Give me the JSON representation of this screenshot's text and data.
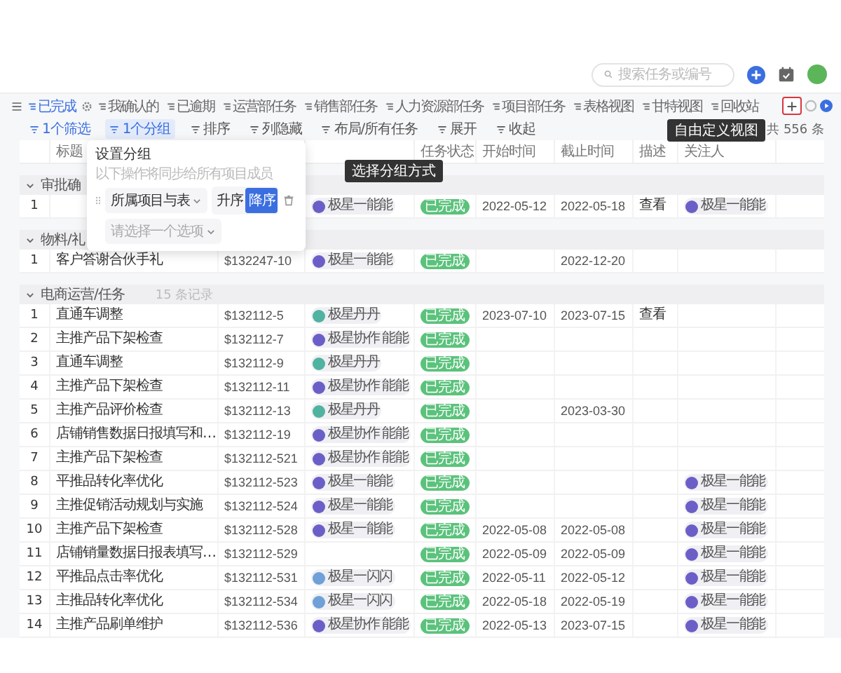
{
  "topbar": {
    "search": {
      "placeholder": "搜索任务或编号"
    }
  },
  "tabs": [
    {
      "label": "已完成",
      "selected": true
    },
    {
      "label": "我确认的",
      "selected": false
    },
    {
      "label": "已逾期",
      "selected": false
    },
    {
      "label": "运营部任务",
      "selected": false
    },
    {
      "label": "销售部任务",
      "selected": false
    },
    {
      "label": "人力资源部任务",
      "selected": false
    },
    {
      "label": "项目部任务",
      "selected": false
    },
    {
      "label": "表格视图",
      "selected": false
    },
    {
      "label": "甘特视图",
      "selected": false
    },
    {
      "label": "回收站",
      "selected": false
    }
  ],
  "toolbar": [
    {
      "label": "1个筛选",
      "active": true,
      "selected": false
    },
    {
      "label": "1个分组",
      "active": true,
      "selected": true
    },
    {
      "label": "排序",
      "active": false,
      "selected": false
    },
    {
      "label": "列隐藏",
      "active": false,
      "selected": false
    },
    {
      "label": "布局/所有任务",
      "active": false,
      "selected": false
    },
    {
      "label": "展开",
      "active": false,
      "selected": false
    },
    {
      "label": "收起",
      "active": false,
      "selected": false
    }
  ],
  "record_count": "共 556 条",
  "add_view_tooltip": "自由定义视图",
  "group_tooltip": "选择分组方式",
  "group_popover": {
    "title": "设置分组",
    "hint": "以下操作将同步给所有项目成员",
    "field": "所属项目与表",
    "sort": [
      {
        "label": "升序",
        "selected": false
      },
      {
        "label": "降序",
        "selected": true
      }
    ],
    "second_placeholder": "请选择一个选项"
  },
  "headers": {
    "title": "标题",
    "status": "任务状态",
    "start": "开始时间",
    "end": "截止时间",
    "desc": "描述",
    "watcher": "关注人"
  },
  "groups": [
    {
      "name": "审批确",
      "expanded": true,
      "rows": [
        {
          "index": "1",
          "assignee": {
            "name": "极星一能能",
            "color": "#6b5fc7"
          },
          "status": "已完成",
          "start": "2022-05-12",
          "end": "2022-05-18",
          "desc": "查看",
          "watcher": {
            "name": "极星一能能",
            "color": "#6b5fc7"
          }
        }
      ]
    },
    {
      "name": "物料/礼",
      "expanded": true,
      "rows": [
        {
          "index": "1",
          "title": "客户答谢合伙手礼",
          "code": "$132247-10",
          "assignee": {
            "name": "极星一能能",
            "color": "#6b5fc7"
          },
          "status": "已完成",
          "end": "2022-12-20"
        }
      ]
    },
    {
      "name": "电商运营/任务",
      "note": "15 条记录",
      "expanded": true,
      "rows": [
        {
          "index": "1",
          "title": "直通车调整",
          "code": "$132112-5",
          "assignee": {
            "name": "极星丹丹",
            "color": "#4fb3a0"
          },
          "status": "已完成",
          "start": "2023-07-10",
          "end": "2023-07-15",
          "desc": "查看"
        },
        {
          "index": "2",
          "title": "主推产品下架检查",
          "code": "$132112-7",
          "assignee": {
            "name": "极星协作 能能",
            "color": "#6b5fc7"
          },
          "status": "已完成"
        },
        {
          "index": "3",
          "title": "直通车调整",
          "code": "$132112-9",
          "assignee": {
            "name": "极星丹丹",
            "color": "#4fb3a0"
          },
          "status": "已完成"
        },
        {
          "index": "4",
          "title": "主推产品下架检查",
          "code": "$132112-11",
          "assignee": {
            "name": "极星协作 能能",
            "color": "#6b5fc7"
          },
          "status": "已完成"
        },
        {
          "index": "5",
          "title": "主推产品评价检查",
          "code": "$132112-13",
          "assignee": {
            "name": "极星丹丹",
            "color": "#4fb3a0"
          },
          "status": "已完成",
          "end": "2023-03-30"
        },
        {
          "index": "6",
          "title": "店铺销售数据日报填写和…",
          "code": "$132112-19",
          "assignee": {
            "name": "极星协作 能能",
            "color": "#6b5fc7"
          },
          "status": "已完成"
        },
        {
          "index": "7",
          "title": "主推产品下架检查",
          "code": "$132112-521",
          "assignee": {
            "name": "极星协作 能能",
            "color": "#6b5fc7"
          },
          "status": "已完成"
        },
        {
          "index": "8",
          "title": "平推品转化率优化",
          "code": "$132112-523",
          "assignee": {
            "name": "极星一能能",
            "color": "#6b5fc7"
          },
          "status": "已完成",
          "watcher": {
            "name": "极星一能能",
            "color": "#6b5fc7"
          }
        },
        {
          "index": "9",
          "title": "主推促销活动规划与实施",
          "code": "$132112-524",
          "assignee": {
            "name": "极星一能能",
            "color": "#6b5fc7"
          },
          "status": "已完成",
          "watcher": {
            "name": "极星一能能",
            "color": "#6b5fc7"
          }
        },
        {
          "index": "10",
          "title": "主推产品下架检查",
          "code": "$132112-528",
          "assignee": {
            "name": "极星一能能",
            "color": "#6b5fc7"
          },
          "status": "已完成",
          "start": "2022-05-08",
          "end": "2022-05-08",
          "watcher": {
            "name": "极星一能能",
            "color": "#6b5fc7"
          }
        },
        {
          "index": "11",
          "title": "店铺销量数据日报表填写…",
          "code": "$132112-529",
          "status": "已完成",
          "start": "2022-05-09",
          "end": "2022-05-09",
          "watcher": {
            "name": "极星一能能",
            "color": "#6b5fc7"
          }
        },
        {
          "index": "12",
          "title": "平推品点击率优化",
          "code": "$132112-531",
          "assignee": {
            "name": "极星一闪闪",
            "color": "#6fa0d8"
          },
          "status": "已完成",
          "start": "2022-05-11",
          "end": "2022-05-12",
          "watcher": {
            "name": "极星一能能",
            "color": "#6b5fc7"
          }
        },
        {
          "index": "13",
          "title": "主推品转化率优化",
          "code": "$132112-534",
          "assignee": {
            "name": "极星一闪闪",
            "color": "#6fa0d8"
          },
          "status": "已完成",
          "start": "2022-05-18",
          "end": "2022-05-19",
          "watcher": {
            "name": "极星一能能",
            "color": "#6b5fc7"
          }
        },
        {
          "index": "14",
          "title": "主推产品刷单维护",
          "code": "$132112-536",
          "assignee": {
            "name": "极星协作 能能",
            "color": "#6b5fc7"
          },
          "status": "已完成",
          "start": "2022-05-13",
          "end": "2023-07-15",
          "watcher": {
            "name": "极星一能能",
            "color": "#6b5fc7"
          }
        }
      ]
    }
  ]
}
